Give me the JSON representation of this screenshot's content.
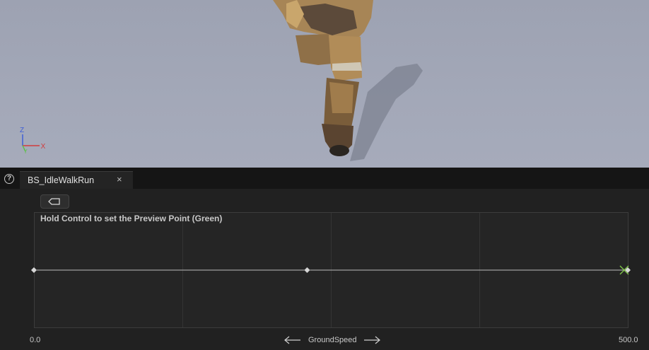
{
  "viewport": {
    "axes": {
      "z": "Z",
      "y": "Y",
      "x": "X"
    }
  },
  "tabs": [
    {
      "label": "BS_IdleWalkRun",
      "close": "×"
    }
  ],
  "help_icon": "?",
  "editor": {
    "hint": "Hold Control to set the Preview Point (Green)",
    "axis_min": "0.0",
    "axis_max": "500.0",
    "axis_name": "GroundSpeed",
    "sample_points": [
      0,
      230,
      500
    ],
    "preview_point": 497,
    "colors": {
      "line": "#bdbdbd",
      "point": "#d7d7d7",
      "preview": "#7ec248"
    }
  }
}
